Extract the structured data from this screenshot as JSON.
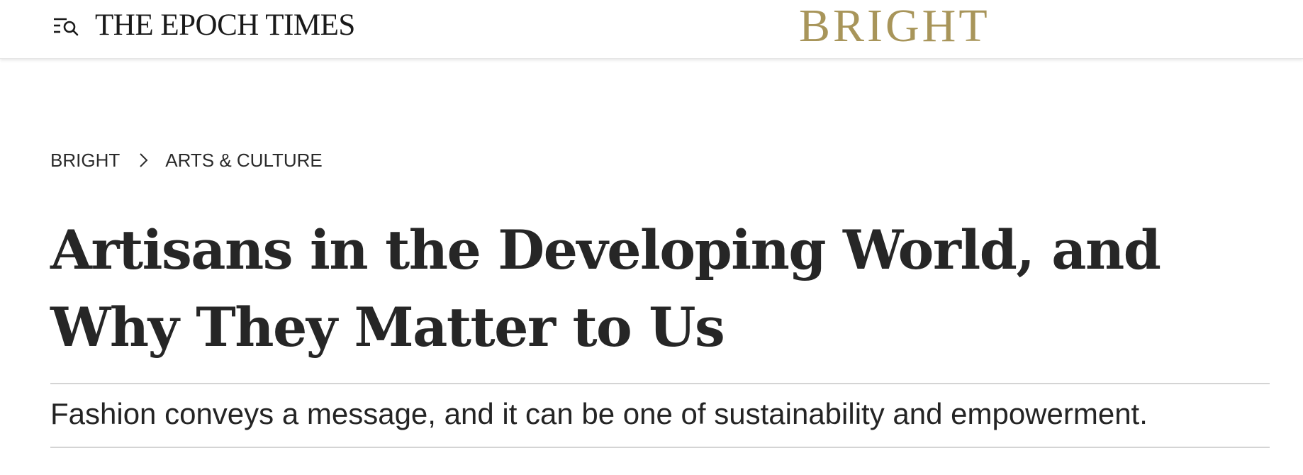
{
  "header": {
    "menu_icon": "menu-search-icon",
    "site_name": "THE EPOCH TIMES",
    "section_brand": "BRIGHT",
    "section_brand_color": "#A8955A"
  },
  "breadcrumb": {
    "items": [
      {
        "label": "BRIGHT"
      },
      {
        "label": "ARTS & CULTURE"
      }
    ],
    "separator_icon": "chevron-right-icon"
  },
  "article": {
    "title": "Artisans in the Developing World, and Why They Matter to Us",
    "subtitle": "Fashion conveys a message, and it can be one of sustainability and empowerment."
  },
  "colors": {
    "text": "#242424",
    "divider": "#D4D4D4"
  }
}
